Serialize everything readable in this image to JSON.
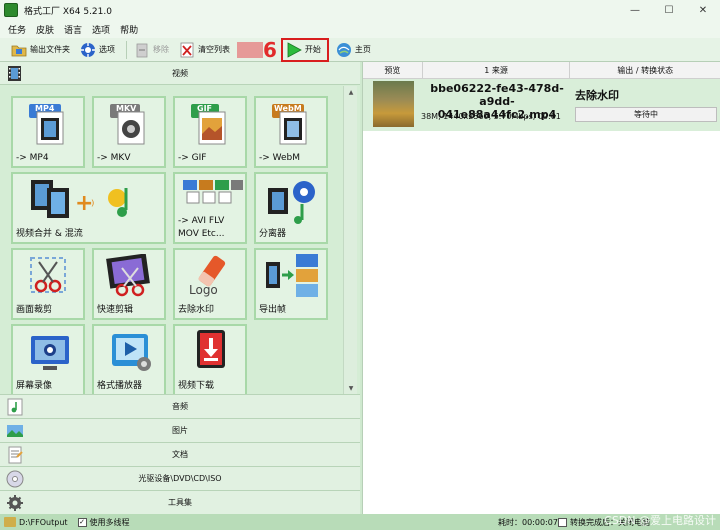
{
  "window": {
    "title": "格式工厂 X64 5.21.0"
  },
  "menu": [
    "任务",
    "皮肤",
    "语言",
    "选项",
    "帮助"
  ],
  "toolbar": {
    "output_folder": "输出文件夹",
    "options": "选项",
    "remove": "移除",
    "clear_list": "清空列表",
    "step_marker": "6",
    "start": "开始",
    "home": "主页"
  },
  "left": {
    "video_header": "视频",
    "tiles": [
      {
        "label": "-> MP4",
        "badge": "MP4",
        "badge_color": "#3a7bd5"
      },
      {
        "label": "-> MKV",
        "badge": "MKV",
        "badge_color": "#7a7a7a"
      },
      {
        "label": "-> GIF",
        "badge": "GIF",
        "badge_color": "#2e9e4a"
      },
      {
        "label": "-> WebM",
        "badge": "WebM",
        "badge_color": "#c77b1e"
      },
      {
        "label": "视频合并 & 混流"
      },
      {
        "label_line1": "-> AVI FLV",
        "label_line2": "MOV Etc..."
      },
      {
        "label": "分离器"
      },
      {
        "label": "画面裁剪"
      },
      {
        "label": "快速剪辑"
      },
      {
        "label": "去除水印"
      },
      {
        "label": "导出帧"
      },
      {
        "label": "屏幕录像"
      },
      {
        "label": "格式播放器"
      },
      {
        "label": "视频下载"
      }
    ],
    "categories": [
      "音频",
      "图片",
      "文档",
      "光驱设备\\DVD\\CD\\ISO",
      "工具集"
    ]
  },
  "right": {
    "columns": [
      "预览",
      "1 来源",
      "输出 / 转换状态"
    ],
    "task": {
      "name": "bbe06222-fe43-478d-a9dd-041e88a44fc2.mp4",
      "meta": "38M, 1440x2560, 5.70Mbps, 00:01",
      "output": "去除水印",
      "status": "等待中"
    }
  },
  "statusbar": {
    "folder": "D:\\FFOutput",
    "multithread": "使用多线程",
    "elapsed": "耗时：00:00:07",
    "after_done": "转换完成后：关闭电脑"
  },
  "watermark": "CSDN @爱上电路设计"
}
